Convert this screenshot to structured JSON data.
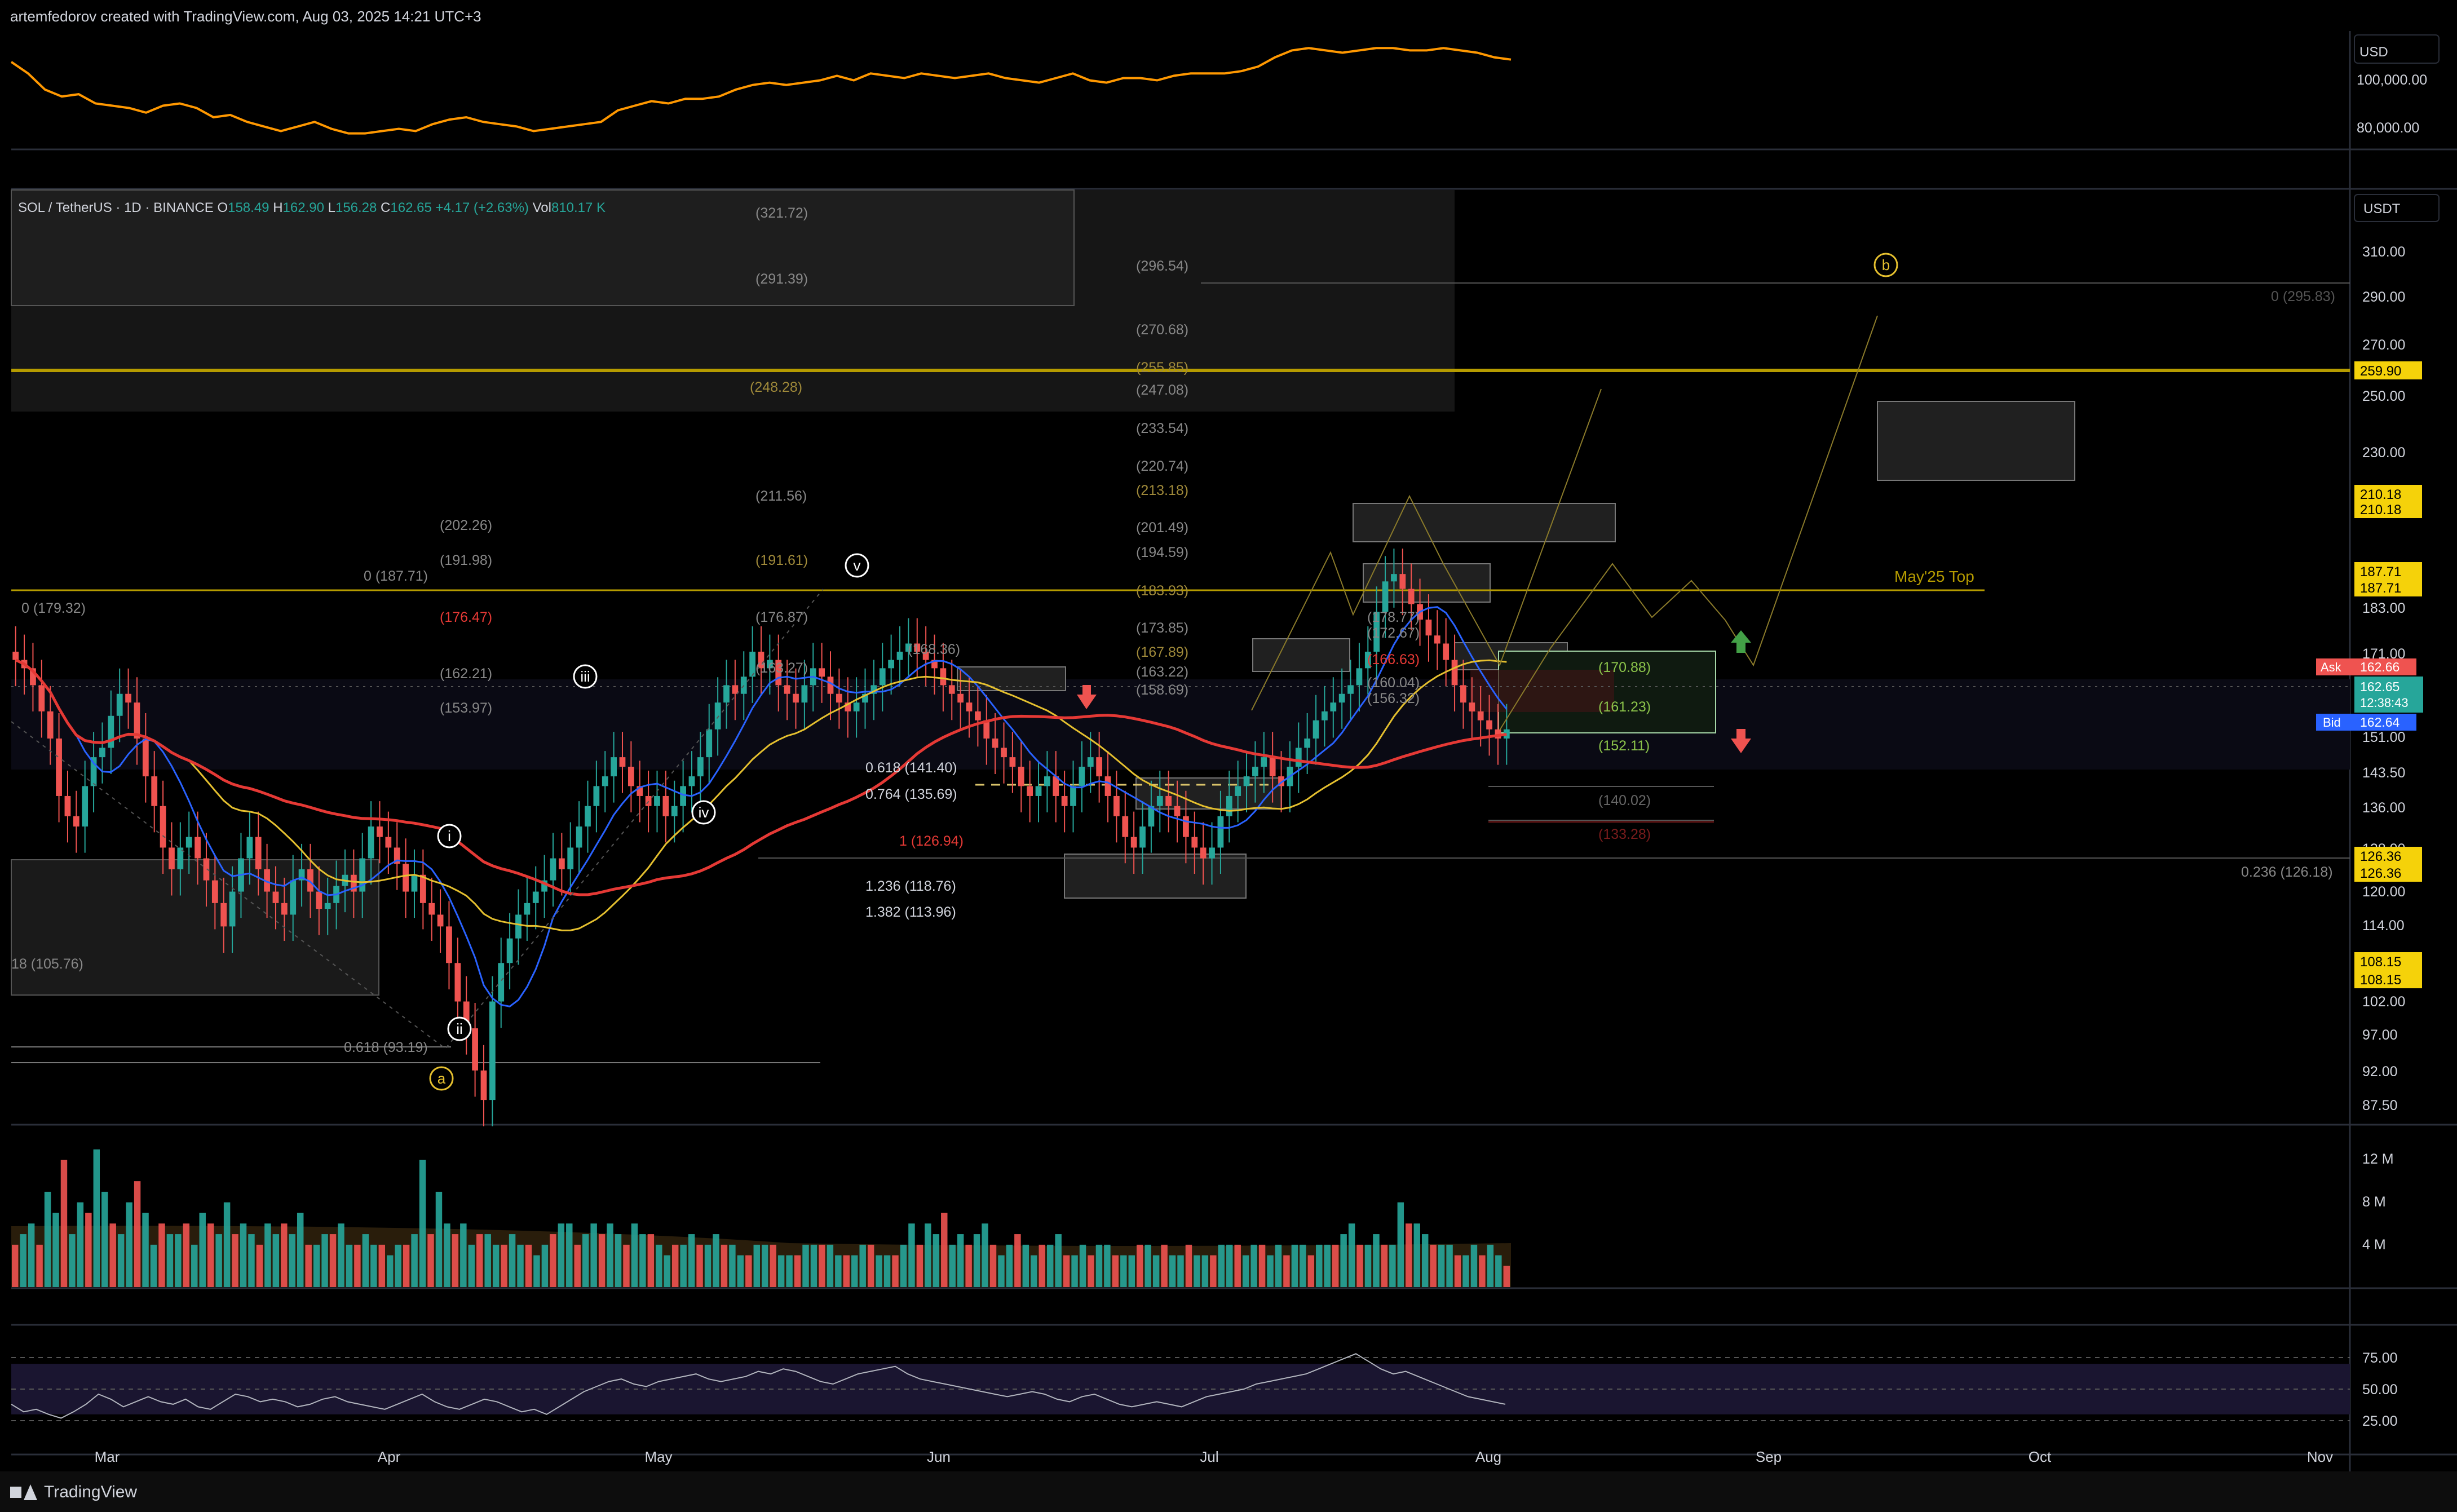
{
  "header": {
    "credit": "artemfedorov created with TradingView.com, Aug 03, 2025 14:21 UTC+3"
  },
  "footer": {
    "brand": "TradingView"
  },
  "chart_data": {
    "type": "candlestick",
    "symbol": "SOL / TetherUS · 1D · BINANCE",
    "legend": {
      "open_label": "O",
      "open": "158.49",
      "high_label": "H",
      "high": "162.90",
      "low_label": "L",
      "low": "156.28",
      "close_label": "C",
      "close": "162.65",
      "change": "+4.17 (+2.63%)",
      "vol_label": "Vol",
      "vol": "810.17 K"
    },
    "currency_top": "USD",
    "currency_main": "USDT",
    "x_ticks": [
      "Mar",
      "Apr",
      "May",
      "Jun",
      "Jul",
      "Aug",
      "Sep",
      "Oct",
      "Nov"
    ],
    "top_pane": {
      "series": "USD comparison",
      "ticks": [
        "100,000.00",
        "80,000.00"
      ],
      "values": [
        113000,
        108000,
        101000,
        98000,
        99000,
        95000,
        94000,
        93000,
        91000,
        94000,
        95000,
        93000,
        89000,
        90000,
        87000,
        85000,
        83000,
        85000,
        87000,
        84000,
        82000,
        82000,
        83000,
        84000,
        83000,
        86000,
        88000,
        89000,
        87000,
        86000,
        85000,
        83000,
        84000,
        85000,
        86000,
        87000,
        92000,
        94000,
        96000,
        95000,
        97000,
        97000,
        98000,
        101000,
        103000,
        104000,
        103000,
        104000,
        105000,
        107000,
        105000,
        108000,
        107000,
        106000,
        108000,
        107000,
        106000,
        107000,
        108000,
        106000,
        105000,
        104000,
        106000,
        108000,
        105000,
        104000,
        106000,
        106000,
        105000,
        107000,
        108000,
        108000,
        108000,
        109000,
        111000,
        115000,
        118000,
        119000,
        118000,
        117000,
        118000,
        119000,
        119000,
        118000,
        118000,
        119000,
        118000,
        117000,
        115000,
        114000
      ]
    },
    "main_ticks": [
      "310.00",
      "290.00",
      "270.00",
      "250.00",
      "230.00",
      "210.00",
      "187.71",
      "183.00",
      "171.00",
      "151.00",
      "143.50",
      "136.00",
      "128.00",
      "120.00",
      "114.00",
      "102.00",
      "97.00",
      "92.00",
      "87.50"
    ],
    "price_tags": [
      {
        "label": "259.90",
        "kind": "yellow"
      },
      {
        "label": "210.18",
        "kind": "yellow"
      },
      {
        "label": "210.18",
        "kind": "yellow"
      },
      {
        "label": "187.71",
        "kind": "yellow"
      },
      {
        "label": "187.71",
        "kind": "yellow"
      },
      {
        "label": "126.36",
        "kind": "yellow"
      },
      {
        "label": "126.36",
        "kind": "yellow"
      },
      {
        "label": "108.15",
        "kind": "yellow"
      },
      {
        "label": "108.15",
        "kind": "yellow"
      }
    ],
    "quote": {
      "ask_label": "Ask",
      "ask": "162.66",
      "last": "162.65",
      "countdown": "12:38:43",
      "bid_label": "Bid",
      "bid": "162.64"
    },
    "annotations": {
      "fib_left": [
        "(202.26)",
        "(191.98)",
        "0 (187.71)",
        "(176.47)",
        "(162.21)",
        "(153.97)",
        "0 (179.32)",
        "18 (105.76)",
        "0.618 (93.19)"
      ],
      "fib_mid": [
        "(321.72)",
        "(291.39)",
        "(248.28)",
        "(211.56)",
        "(191.61)",
        "(176.87)",
        "(168.36)",
        "(163.27)",
        "0.618 (141.40)",
        "0.764 (135.69)",
        "1 (126.94)",
        "1.236 (118.76)",
        "1.382 (113.96)"
      ],
      "fib_right": [
        "(296.54)",
        "(270.68)",
        "(255.85)",
        "(247.08)",
        "(233.54)",
        "(220.74)",
        "(213.18)",
        "(201.49)",
        "(194.59)",
        "(183.93)",
        "(173.85)",
        "(167.89)",
        "(163.22)",
        "(158.69)",
        "(178.77)",
        "(172.67)",
        "(166.63)",
        "(160.04)",
        "(156.32)"
      ],
      "zone_labels": [
        "(170.88)",
        "(161.23)",
        "(152.11)",
        "(140.02)",
        "(133.28)"
      ],
      "far_right": [
        "0 (295.83)",
        "0.236 (126.18)"
      ],
      "waves": [
        "i",
        "ii",
        "iii",
        "iv",
        "v",
        "a",
        "b"
      ],
      "may_top": "May'25 Top"
    },
    "volume_pane": {
      "ticks": [
        "12 M",
        "8 M",
        "4 M"
      ],
      "values": [
        4,
        5,
        6,
        4,
        9,
        7,
        12,
        5,
        8,
        7,
        13,
        9,
        6,
        5,
        8,
        10,
        7,
        4,
        6,
        5,
        5,
        6,
        4,
        7,
        6,
        5,
        8,
        5,
        6,
        5,
        4,
        6,
        5,
        6,
        5,
        7,
        4,
        4,
        5,
        5,
        6,
        4,
        4,
        5,
        4,
        4,
        3,
        4,
        4,
        5,
        12,
        5,
        9,
        6,
        5,
        6,
        4,
        5,
        5,
        4,
        4,
        5,
        4,
        4,
        3,
        4,
        5,
        6,
        6,
        4,
        5,
        6,
        5,
        6,
        5,
        4,
        6,
        5,
        5,
        4,
        3,
        4,
        4,
        5,
        4,
        4,
        5,
        4,
        4,
        3,
        3,
        4,
        4,
        4,
        3,
        3,
        3,
        4,
        4,
        4,
        4,
        3,
        3,
        3,
        4,
        4,
        3,
        3,
        3,
        4,
        6,
        4,
        6,
        5,
        7,
        4,
        5,
        4,
        5,
        6,
        4,
        3,
        4,
        5,
        4,
        3,
        4,
        4,
        5,
        3,
        3,
        4,
        3,
        4,
        4,
        3,
        3,
        3,
        4,
        4,
        3,
        4,
        3,
        3,
        4,
        3,
        3,
        3,
        4,
        4,
        4,
        3,
        4,
        4,
        3,
        4,
        3,
        4,
        4,
        3,
        4,
        4,
        4,
        5,
        6,
        4,
        4,
        5,
        4,
        4,
        8,
        6,
        6,
        5,
        4,
        4,
        4,
        3,
        3,
        4,
        3,
        4,
        3,
        2
      ]
    },
    "rsi_pane": {
      "ticks": [
        "75.00",
        "50.00",
        "25.00"
      ],
      "values": [
        38,
        32,
        34,
        30,
        27,
        32,
        38,
        46,
        42,
        36,
        40,
        44,
        40,
        38,
        42,
        36,
        34,
        40,
        46,
        44,
        40,
        42,
        40,
        36,
        38,
        42,
        44,
        40,
        38,
        36,
        34,
        38,
        42,
        46,
        40,
        36,
        34,
        38,
        42,
        40,
        36,
        32,
        34,
        30,
        36,
        42,
        48,
        52,
        56,
        58,
        54,
        52,
        56,
        58,
        60,
        62,
        58,
        56,
        58,
        60,
        64,
        62,
        66,
        64,
        60,
        56,
        54,
        58,
        62,
        64,
        66,
        68,
        62,
        58,
        56,
        54,
        52,
        50,
        48,
        46,
        44,
        46,
        48,
        46,
        42,
        40,
        44,
        46,
        42,
        38,
        36,
        38,
        40,
        38,
        36,
        40,
        44,
        46,
        48,
        50,
        54,
        56,
        58,
        60,
        62,
        66,
        70,
        74,
        78,
        72,
        66,
        62,
        64,
        60,
        56,
        52,
        48,
        44,
        42,
        40,
        38
      ]
    }
  }
}
